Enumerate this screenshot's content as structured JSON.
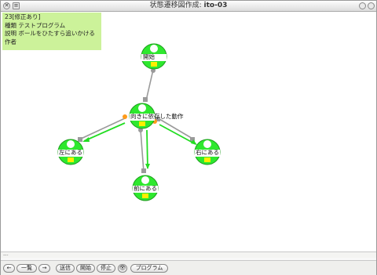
{
  "window": {
    "title_prefix": "状態遷移図作成: ",
    "title_name": "ito-03",
    "close_icon": "✕",
    "menu_icon": "≡"
  },
  "info": {
    "line1": "23[修正あり]",
    "line2": "種類 テストプログラム",
    "line3": "説明 ボールをひたすら追いかける",
    "line4": "作者"
  },
  "nodes": {
    "start": "開始",
    "center": "向きに依存した動作",
    "left": "左にある",
    "front": "前にある",
    "right": "右にある"
  },
  "status": {
    "text": "---"
  },
  "toolbar": {
    "back": "←",
    "list": "一覧",
    "forward": "→",
    "send": "送信",
    "run": "開始",
    "stop": "停止",
    "eye": "👁",
    "program": "プログラム"
  },
  "colors": {
    "node_green": "#2ee82e",
    "info_bg": "#ccf29a",
    "arrow_green": "#22dd22",
    "arrow_gray": "#9a9a9a",
    "connector_orange": "#ff9a1a"
  }
}
